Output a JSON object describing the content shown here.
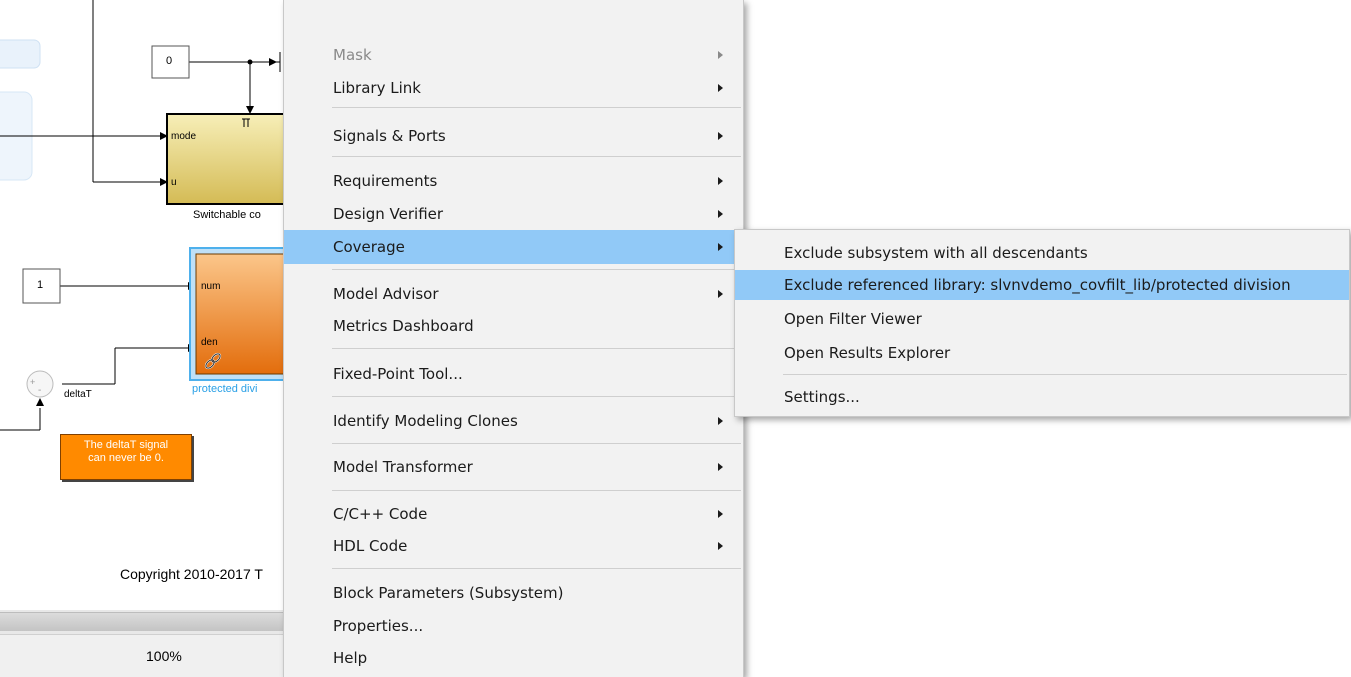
{
  "canvas": {
    "constant_top": "0",
    "constant_bottom": "1",
    "port_mode": "mode",
    "port_u": "u",
    "port_num": "num",
    "port_den": "den",
    "switchable_label": "Switchable co",
    "protected_label": "protected divi",
    "delta_label": "deltaT",
    "annotation_line1": "The deltaT signal",
    "annotation_line2": "can never be 0.",
    "copyright": "Copyright 2010-2017 T",
    "zoom": "100%"
  },
  "context_menu": {
    "items": [
      {
        "label": "Mask",
        "submenu": true,
        "disabled": true
      },
      {
        "label": "Library Link",
        "submenu": true
      },
      {
        "label": "Signals & Ports",
        "submenu": true
      },
      {
        "label": "Requirements",
        "submenu": true
      },
      {
        "label": "Design Verifier",
        "submenu": true
      },
      {
        "label": "Coverage",
        "submenu": true,
        "highlighted": true
      },
      {
        "label": "Model Advisor",
        "submenu": true
      },
      {
        "label": "Metrics Dashboard",
        "submenu": false
      },
      {
        "label": "Fixed-Point Tool...",
        "submenu": false
      },
      {
        "label": "Identify Modeling Clones",
        "submenu": true
      },
      {
        "label": "Model Transformer",
        "submenu": true
      },
      {
        "label": "C/C++ Code",
        "submenu": true
      },
      {
        "label": "HDL Code",
        "submenu": true
      },
      {
        "label": "Block Parameters (Subsystem)",
        "submenu": false
      },
      {
        "label": "Properties...",
        "submenu": false
      },
      {
        "label": "Help",
        "submenu": false
      }
    ]
  },
  "coverage_submenu": {
    "items": [
      {
        "label": "Exclude subsystem with all descendants"
      },
      {
        "label": "Exclude referenced library: slvnvdemo_covfilt_lib/protected division",
        "highlighted": true
      },
      {
        "label": "Open Filter Viewer"
      },
      {
        "label": "Open Results Explorer"
      },
      {
        "label": "Settings..."
      }
    ]
  },
  "colors": {
    "highlight": "#91c9f7",
    "menu_bg": "#f2f2f2",
    "switchable_block": "#e8d47a",
    "protected_block": "#f28a1e",
    "annotation": "#ff8a00",
    "selection": "#4eb0ec"
  }
}
